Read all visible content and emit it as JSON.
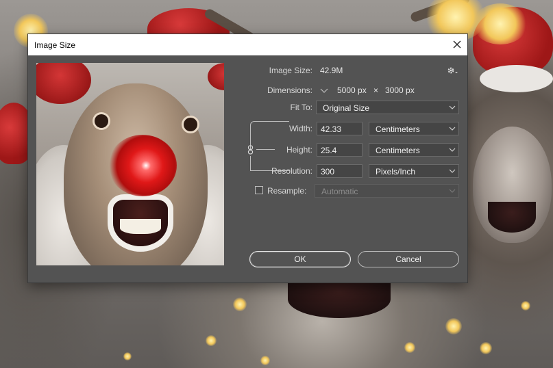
{
  "dialog": {
    "title": "Image Size",
    "image_size_label": "Image Size:",
    "image_size_value": "42.9M",
    "dimensions_label": "Dimensions:",
    "dimensions_width": "5000 px",
    "dimensions_sep": "×",
    "dimensions_height": "3000 px",
    "fit_to_label": "Fit To:",
    "fit_to_value": "Original Size",
    "width_label": "Width:",
    "width_value": "42.33",
    "width_unit": "Centimeters",
    "height_label": "Height:",
    "height_value": "25.4",
    "height_unit": "Centimeters",
    "resolution_label": "Resolution:",
    "resolution_value": "300",
    "resolution_unit": "Pixels/Inch",
    "resample_label": "Resample:",
    "resample_value": "Automatic",
    "resample_checked": false,
    "ok_label": "OK",
    "cancel_label": "Cancel"
  },
  "icons": {
    "close": "close-icon",
    "gear": "gear-icon",
    "chevron": "chevron-down-icon",
    "link": "link-icon"
  },
  "colors": {
    "dialog_bg": "#535353",
    "field_bg": "#454545",
    "titlebar_bg": "#ffffff"
  }
}
